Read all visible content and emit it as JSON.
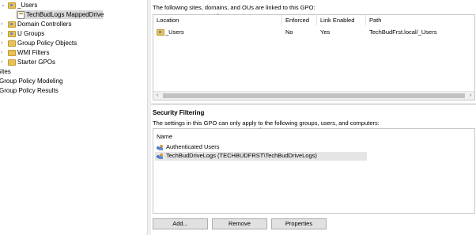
{
  "tree": {
    "users_ou": "_Users",
    "linked_gpo": "TechBudLogs MappedDrive",
    "domain_controllers": "Domain Controllers",
    "u_groups": "U Groups",
    "gpo_container": "Group Policy Objects",
    "wmi_filters": "WMI Filters",
    "starter_gpos": "Starter GPOs",
    "sites": "Sites",
    "modeling": "Group Policy Modeling",
    "results": "Group Policy Results"
  },
  "links": {
    "intro": "The following sites, domains, and OUs are linked to this GPO:",
    "columns": [
      "Location",
      "Enforced",
      "Link Enabled",
      "Path"
    ],
    "rows": [
      {
        "location": "_Users",
        "enforced": "No",
        "link_enabled": "Yes",
        "path": "TechBudFrst.local/_Users"
      }
    ]
  },
  "security": {
    "title": "Security Filtering",
    "intro": "The settings in this GPO can only apply to the following groups, users, and computers:",
    "column": "Name",
    "entries": [
      "Authenticated Users",
      "TechBudDriveLogs (TECHBUDFRST\\TechBudDriveLogs)"
    ],
    "buttons": {
      "add": "Add...",
      "remove": "Remove",
      "properties": "Properties"
    }
  },
  "icons": {
    "ou": "ou-folder-icon",
    "gpo": "gpo-link-icon",
    "folder": "folder-icon",
    "group": "group-icon"
  },
  "colors": {
    "selection": "#d9d9d9",
    "folder": "#e8c15c"
  }
}
